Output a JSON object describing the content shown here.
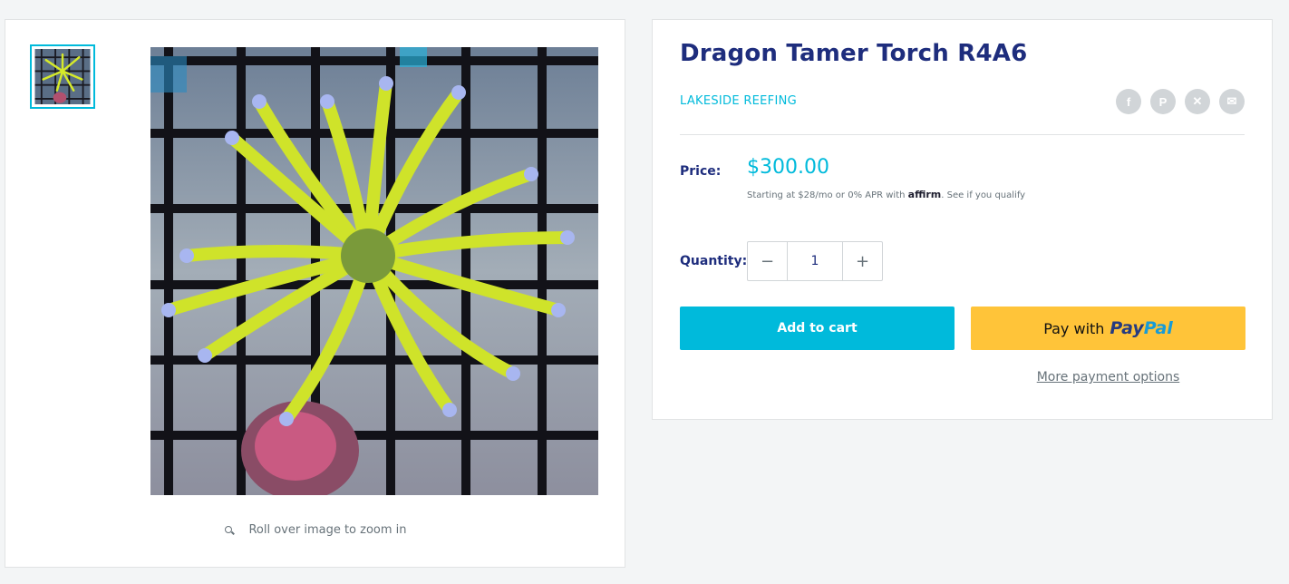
{
  "gallery": {
    "zoom_hint": "Roll over image to zoom in",
    "thumbnail_alt": "Dragon Tamer Torch R4A6 thumbnail",
    "image_alt": "Dragon Tamer Torch R4A6"
  },
  "product": {
    "title": "Dragon Tamer Torch R4A6",
    "vendor": "LAKESIDE REEFING",
    "price_label": "Price:",
    "price": "$300.00",
    "affirm_prefix": "Starting at $28/mo or 0% APR with",
    "affirm_logo": "affirm",
    "affirm_link": ". See if you qualify",
    "quantity_label": "Quantity:",
    "quantity_value": "1",
    "add_to_cart": "Add to cart",
    "paypal_prefix": "Pay with",
    "paypal_pay": "Pay",
    "paypal_pal": "Pal",
    "more_payment": "More payment options"
  },
  "share_icons": [
    "facebook-icon",
    "pinterest-icon",
    "x-icon",
    "email-icon"
  ],
  "colors": {
    "accent": "#00badb",
    "heading": "#1e2d7d",
    "paypal_button": "#ffc439",
    "muted": "#677279"
  }
}
